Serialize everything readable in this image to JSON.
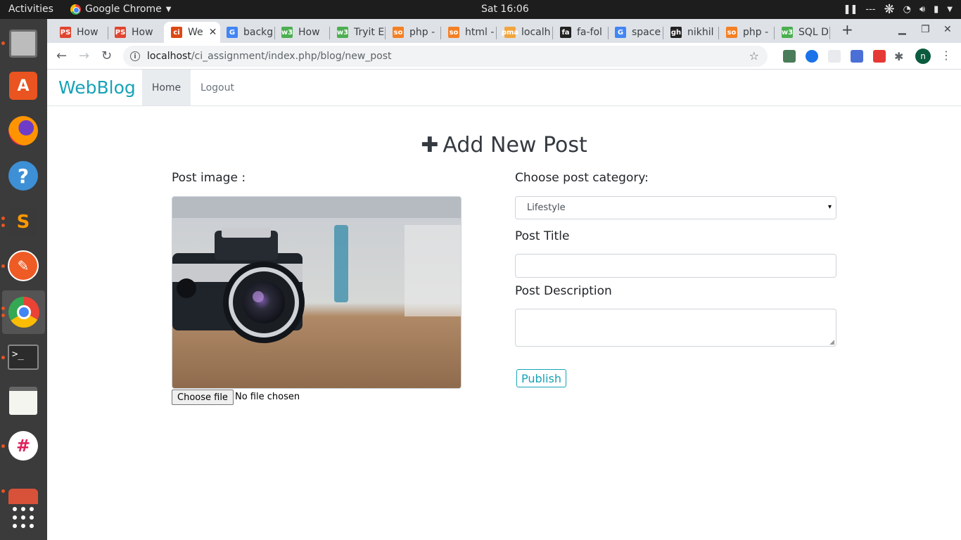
{
  "system": {
    "activities": "Activities",
    "app_name": "Google Chrome",
    "clock": "Sat 16:06",
    "tray_text": "---"
  },
  "browser": {
    "tabs": [
      {
        "label": "How ",
        "favicon": "PS",
        "color": "#e0462f"
      },
      {
        "label": "How ",
        "favicon": "PS",
        "color": "#e0462f"
      },
      {
        "label": "We",
        "favicon": "ci",
        "color": "#dd4814",
        "active": true
      },
      {
        "label": "backg",
        "favicon": "G",
        "color": "#4285f4"
      },
      {
        "label": "How ",
        "favicon": "w3",
        "color": "#4caf50"
      },
      {
        "label": "Tryit E",
        "favicon": "w3",
        "color": "#4caf50"
      },
      {
        "label": "php - ",
        "favicon": "so",
        "color": "#f48024"
      },
      {
        "label": "html - ",
        "favicon": "so",
        "color": "#f48024"
      },
      {
        "label": "localh",
        "favicon": "pma",
        "color": "#f2a53c"
      },
      {
        "label": "fa-fol",
        "favicon": "fa",
        "color": "#222222"
      },
      {
        "label": "space",
        "favicon": "G",
        "color": "#4285f4"
      },
      {
        "label": "nikhil",
        "favicon": "gh",
        "color": "#222222"
      },
      {
        "label": "php - ",
        "favicon": "so",
        "color": "#f48024"
      },
      {
        "label": "SQL D",
        "favicon": "w3",
        "color": "#4caf50"
      }
    ],
    "url_host": "localhost",
    "url_path": "/ci_assignment/index.php/blog/new_post",
    "profile_initial": "n"
  },
  "site": {
    "brand": "WebBlog",
    "nav": {
      "home": "Home",
      "logout": "Logout"
    },
    "heading": "Add New Post",
    "post_image_label": "Post image :",
    "file_button": "Choose file",
    "file_status": "No file chosen",
    "category_label": "Choose post category:",
    "category_selected": "Lifestyle",
    "title_label": "Post Title",
    "title_value": "",
    "description_label": "Post Description",
    "description_value": "",
    "publish": "Publish"
  },
  "colors": {
    "accent": "#17a2b8",
    "navbar_active_bg": "#e9ecef",
    "dock_bg": "#3b3b3b",
    "ubuntu_orange": "#e95420"
  }
}
